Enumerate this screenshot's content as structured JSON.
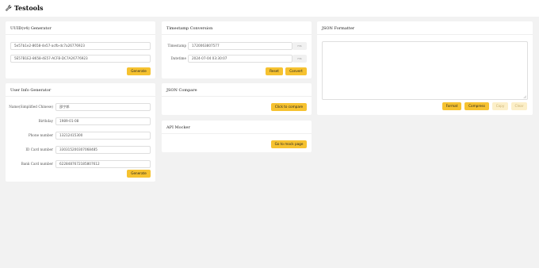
{
  "app": {
    "title": "Testools"
  },
  "uuid": {
    "title": "UUID(v4) Generator",
    "lower": "5e57b1e2-8658-4e57-acfb-dc7a26776923",
    "upper": "5E57B1E2-8658-4E57-ACFB-DC7A26776923",
    "generate": "Generate"
  },
  "user": {
    "title": "User Info Generator",
    "rows": [
      {
        "label": "Name(Simplified Chinese)",
        "value": "邵宁郎"
      },
      {
        "label": "Birthday",
        "value": "1989-01-08"
      },
      {
        "label": "Phone number",
        "value": "13212415300"
      },
      {
        "label": "ID Card number",
        "value": "330315200307068485"
      },
      {
        "label": "Bank Card number",
        "value": "6228487672185807612"
      }
    ],
    "generate": "Generate"
  },
  "timestamp": {
    "title": "Timestamp Conversion",
    "timestamp_label": "Timestamp",
    "timestamp_value": "1720063807577",
    "timestamp_unit": "ms",
    "datetime_label": "Datetime",
    "datetime_value": "2024-07-04 03:30:07",
    "datetime_unit": "ms",
    "reset": "Reset",
    "convert": "Convert"
  },
  "json_compare": {
    "title": "JSON Compare",
    "button": "Click to compare"
  },
  "api_mocker": {
    "title": "API Mocker",
    "button": "Go to mock page"
  },
  "json_formatter": {
    "title": "JSON Formatter",
    "content": "",
    "format": "Format",
    "compress": "Compress",
    "copy": "Copy",
    "clear": "Clear"
  },
  "colors": {
    "accent": "#f6c230",
    "accent_disabled": "#fcefc8",
    "background": "#f2f2f2"
  }
}
